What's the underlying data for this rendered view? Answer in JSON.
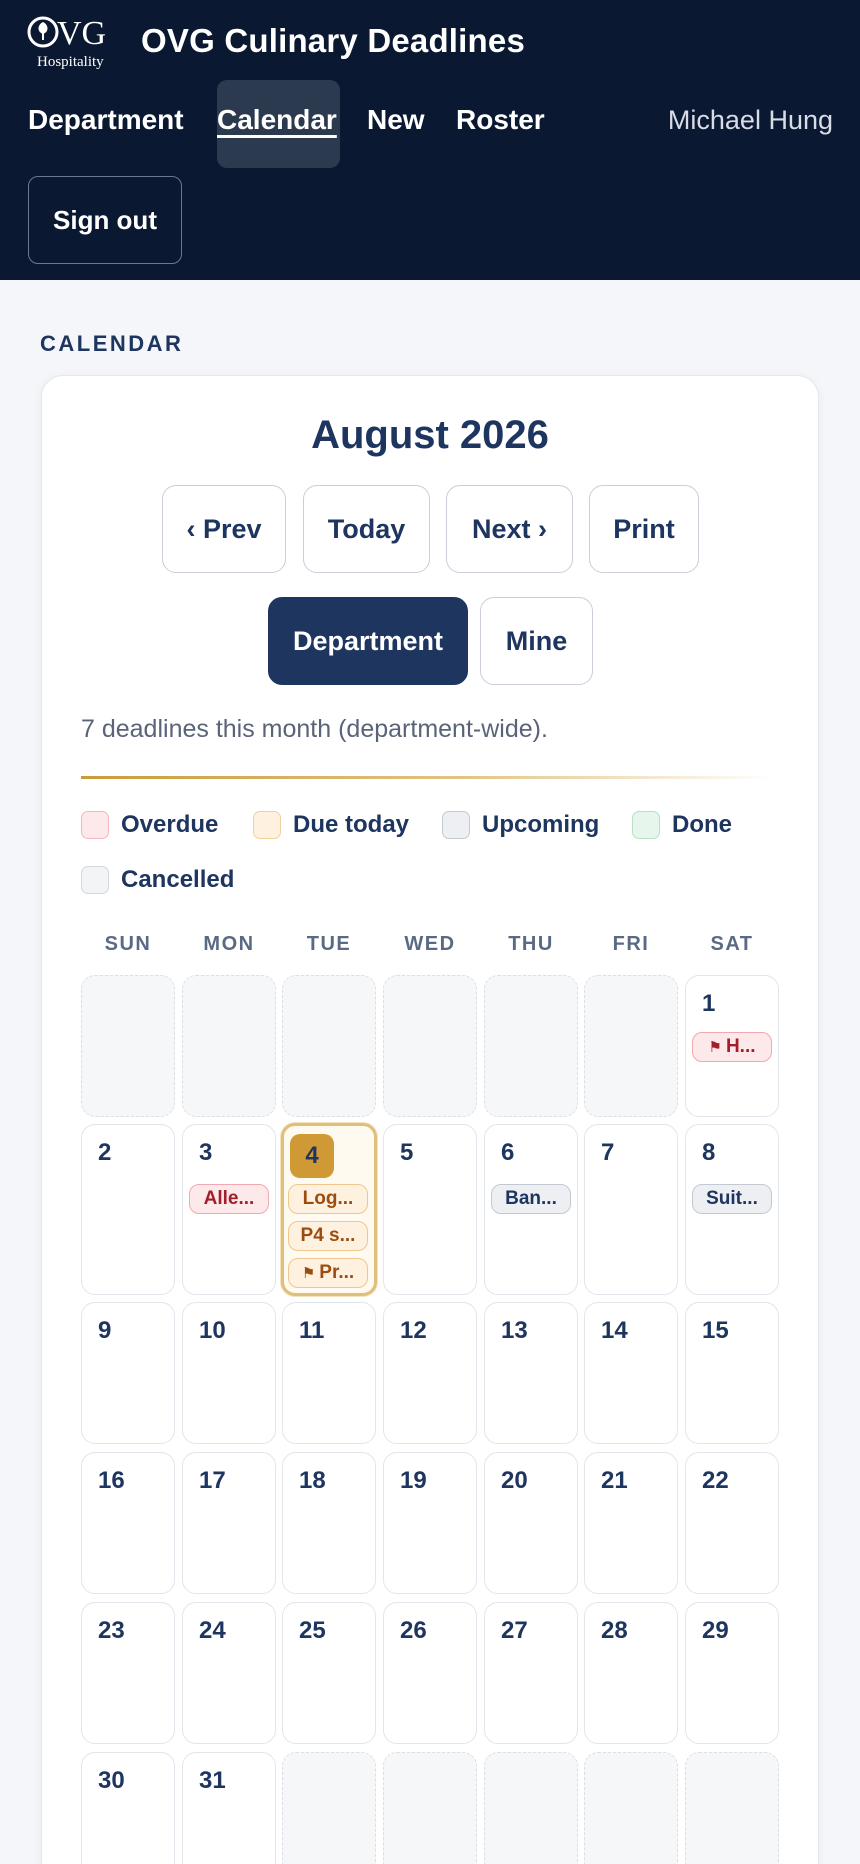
{
  "header": {
    "logo_text": "OVG",
    "logo_sub": "Hospitality",
    "title": "OVG Culinary Deadlines",
    "nav": [
      "Department",
      "Calendar",
      "New",
      "Roster"
    ],
    "user": "Michael Hung",
    "signout": "Sign out"
  },
  "section_label": "CALENDAR",
  "calendar": {
    "month_title": "August 2026",
    "buttons": {
      "prev": "‹ Prev",
      "today": "Today",
      "next": "Next ›",
      "print": "Print"
    },
    "scope": {
      "department": "Department",
      "mine": "Mine",
      "selected": "Department"
    },
    "summary": "7 deadlines this month (department-wide).",
    "legend": [
      {
        "label": "Overdue",
        "color": "#fde8ea"
      },
      {
        "label": "Due today",
        "color": "#fff1df"
      },
      {
        "label": "Upcoming",
        "color": "#edeff3"
      },
      {
        "label": "Done",
        "color": "#e6f6ec"
      },
      {
        "label": "Cancelled",
        "color": "#f3f4f6"
      }
    ],
    "weekdays": [
      "SUN",
      "MON",
      "TUE",
      "WED",
      "THU",
      "FRI",
      "SAT"
    ],
    "days": [
      "1",
      "2",
      "3",
      "4",
      "5",
      "6",
      "7",
      "8",
      "9",
      "10",
      "11",
      "12",
      "13",
      "14",
      "15",
      "16",
      "17",
      "18",
      "19",
      "20",
      "21",
      "22",
      "23",
      "24",
      "25",
      "26",
      "27",
      "28",
      "29",
      "30",
      "31"
    ],
    "events": {
      "d1": {
        "text": "H...",
        "status": "overdue",
        "flag": true
      },
      "d3": {
        "text": "Alle...",
        "status": "overdue"
      },
      "d4a": {
        "text": "Log...",
        "status": "duetoday"
      },
      "d4b": {
        "text": "P4 s...",
        "status": "duetoday"
      },
      "d4c": {
        "text": "Pr...",
        "status": "duetoday",
        "flag": true
      },
      "d6": {
        "text": "Ban...",
        "status": "upcoming"
      },
      "d8": {
        "text": "Suit...",
        "status": "upcoming"
      }
    }
  }
}
